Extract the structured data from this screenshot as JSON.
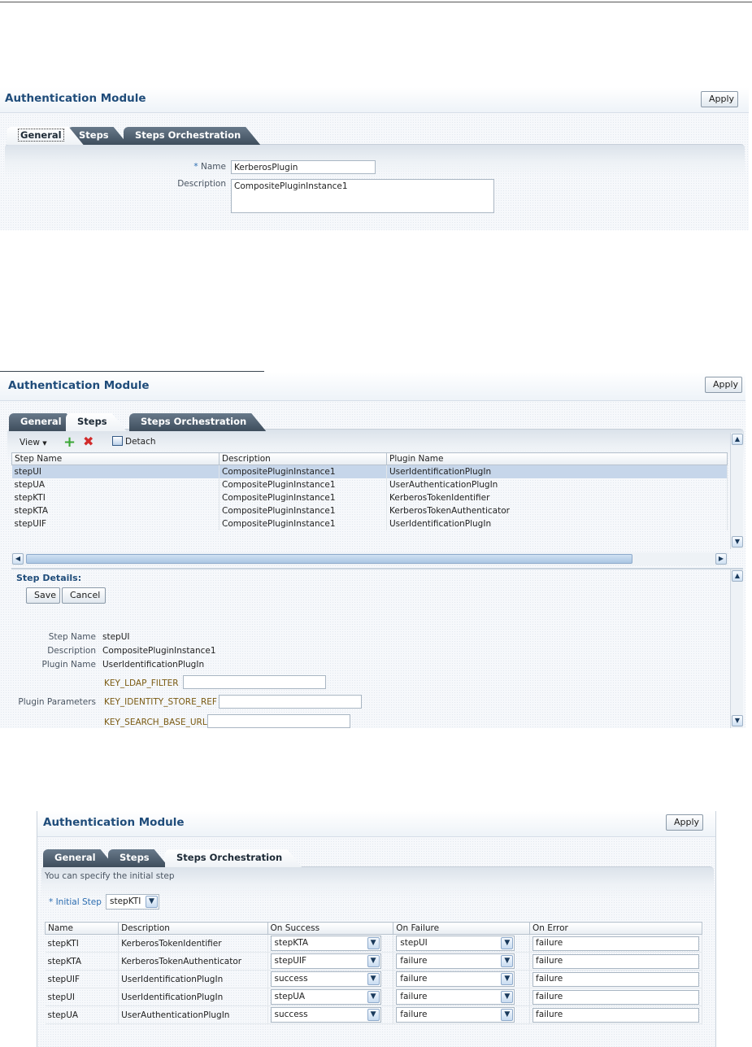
{
  "panel1": {
    "title": "Authentication Module",
    "apply_label": "Apply",
    "tabs": [
      {
        "label": "General"
      },
      {
        "label": "Steps"
      },
      {
        "label": "Steps Orchestration"
      }
    ],
    "name_required": "*",
    "name_label": "Name",
    "name_value": "KerberosPlugin",
    "description_label": "Description",
    "description_value": "CompositePluginInstance1"
  },
  "panel2": {
    "title": "Authentication Module",
    "apply_label": "Apply",
    "tabs": [
      {
        "label": "General"
      },
      {
        "label": "Steps"
      },
      {
        "label": "Steps Orchestration"
      }
    ],
    "toolbar": {
      "view_label": "View",
      "detach_label": "Detach"
    },
    "columns": [
      "Step Name",
      "Description",
      "Plugin Name"
    ],
    "rows": [
      {
        "step": "stepUI",
        "description": "CompositePluginInstance1",
        "plugin": "UserIdentificationPlugIn"
      },
      {
        "step": "stepUA",
        "description": "CompositePluginInstance1",
        "plugin": "UserAuthenticationPlugIn"
      },
      {
        "step": "stepKTI",
        "description": "CompositePluginInstance1",
        "plugin": "KerberosTokenIdentifier"
      },
      {
        "step": "stepKTA",
        "description": "CompositePluginInstance1",
        "plugin": "KerberosTokenAuthenticator"
      },
      {
        "step": "stepUIF",
        "description": "CompositePluginInstance1",
        "plugin": "UserIdentificationPlugIn"
      }
    ],
    "details": {
      "heading": "Step Details:",
      "save_label": "Save",
      "cancel_label": "Cancel",
      "step_name_label": "Step Name",
      "step_name_value": "stepUI",
      "description_label": "Description",
      "description_value": "CompositePluginInstance1",
      "plugin_name_label": "Plugin Name",
      "plugin_name_value": "UserIdentificationPlugIn",
      "plugin_parameters_label": "Plugin Parameters",
      "params": [
        "KEY_LDAP_FILTER",
        "KEY_IDENTITY_STORE_REF",
        "KEY_SEARCH_BASE_URL"
      ]
    }
  },
  "panel3": {
    "title": "Authentication Module",
    "apply_label": "Apply",
    "tabs": [
      {
        "label": "General"
      },
      {
        "label": "Steps"
      },
      {
        "label": "Steps Orchestration"
      }
    ],
    "hint": "You can specify the initial step",
    "initial_step_label": "* Initial Step",
    "initial_step_value": "stepKTI",
    "columns": [
      "Name",
      "Description",
      "On Success",
      "On Failure",
      "On Error"
    ],
    "rows": [
      {
        "name": "stepKTI",
        "description": "KerberosTokenIdentifier",
        "success": "stepKTA",
        "failure": "stepUI",
        "error": "failure"
      },
      {
        "name": "stepKTA",
        "description": "KerberosTokenAuthenticator",
        "success": "stepUIF",
        "failure": "failure",
        "error": "failure"
      },
      {
        "name": "stepUIF",
        "description": "UserIdentificationPlugIn",
        "success": "success",
        "failure": "failure",
        "error": "failure"
      },
      {
        "name": "stepUI",
        "description": "UserIdentificationPlugIn",
        "success": "stepUA",
        "failure": "failure",
        "error": "failure"
      },
      {
        "name": "stepUA",
        "description": "UserAuthenticationPlugIn",
        "success": "success",
        "failure": "failure",
        "error": "failure"
      }
    ]
  },
  "colors": {
    "title": "#1f4c7a",
    "tab_dark": "#4a5a6a",
    "selected_row": "#c6d6ea",
    "add": "#3aa635",
    "delete": "#d12b2b"
  },
  "icons": [
    "add-icon",
    "delete-icon",
    "detach-icon",
    "chevron-down-icon",
    "scroll-up-icon",
    "scroll-down-icon",
    "scroll-left-icon",
    "scroll-right-icon"
  ]
}
